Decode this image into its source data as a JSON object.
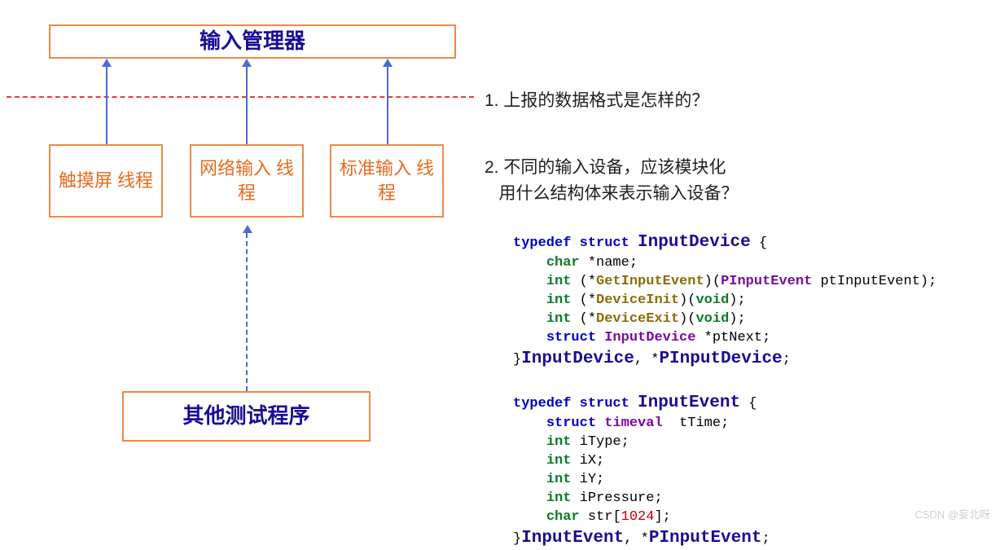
{
  "diagram": {
    "manager": "输入管理器",
    "threads": [
      "触摸屏\n线程",
      "网络输入\n线程",
      "标准输入\n线程"
    ],
    "tester": "其他测试程序"
  },
  "questions": {
    "q1": "1. 上报的数据格式是怎样的？",
    "q2a": "2. 不同的输入设备，应该模块化",
    "q2b": "   用什么结构体来表示输入设备？"
  },
  "code1": {
    "l1_typedef": "typedef",
    "l1_struct": "struct",
    "l1_name": "InputDevice",
    "l1_brace": " {",
    "l2_char": "char",
    "l2_rest": " *",
    "l2_name": "name",
    "l2_semi": ";",
    "l3_int": "int",
    "l3_p": " (*",
    "l3_fn": "GetInputEvent",
    "l3_s": ")(",
    "l3_ty": "PInputEvent",
    "l3_arg": " ptInputEvent);",
    "l4_int": "int",
    "l4_p": " (*",
    "l4_fn": "DeviceInit",
    "l4_s": ")(",
    "l4_void": "void",
    "l4_e": ");",
    "l5_int": "int",
    "l5_p": " (*",
    "l5_fn": "DeviceExit",
    "l5_s": ")(",
    "l5_void": "void",
    "l5_e": ");",
    "l6_struct": "struct",
    "l6_ty": "InputDevice",
    "l6_p": " *",
    "l6_n": "ptNext",
    "l6_e": ";",
    "l7_close": "}",
    "l7_a": "InputDevice",
    "l7_c": ", *",
    "l7_b": "PInputDevice",
    "l7_e": ";"
  },
  "code2": {
    "l1_typedef": "typedef",
    "l1_struct": "struct",
    "l1_name": "InputEvent",
    "l1_brace": " {",
    "l2_struct": "struct",
    "l2_ty": "timeval",
    "l2_sp": "  ",
    "l2_n": "tTime",
    "l2_e": ";",
    "l3_int": "int",
    "l3_n": " iType",
    "l3_e": ";",
    "l4_int": "int",
    "l4_n": " iX",
    "l4_e": ";",
    "l5_int": "int",
    "l5_n": " iY",
    "l5_e": ";",
    "l6_int": "int",
    "l6_n": " iPressure",
    "l6_e": ";",
    "l7_char": "char",
    "l7_n": " str",
    "l7_b": "[",
    "l7_num": "1024",
    "l7_e": "];",
    "l8_close": "}",
    "l8_a": "InputEvent",
    "l8_c": ", *",
    "l8_b": "PInputEvent",
    "l8_e": ";"
  },
  "watermark": "CSDN @妄北呀"
}
